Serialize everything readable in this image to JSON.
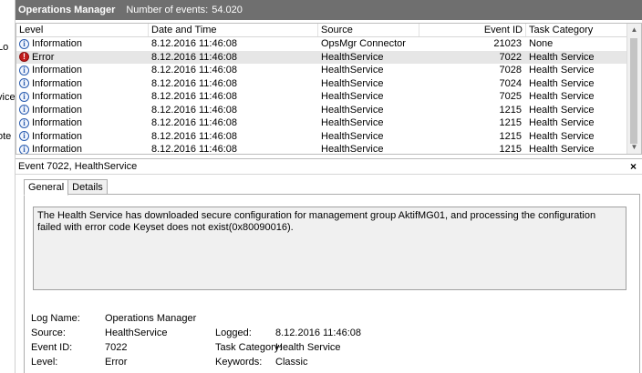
{
  "left_nav": {
    "fragments": [
      "Lo",
      "vice",
      "ote"
    ]
  },
  "header": {
    "title": "Operations Manager",
    "count_label": "Number of events:",
    "count_value": "54.020"
  },
  "columns": {
    "level": "Level",
    "date": "Date and Time",
    "source": "Source",
    "event_id": "Event ID",
    "task": "Task Category"
  },
  "events": [
    {
      "level": "Information",
      "icon": "info-icon",
      "date": "8.12.2016 11:46:08",
      "source": "OpsMgr Connector",
      "event_id": "21023",
      "task": "None"
    },
    {
      "level": "Error",
      "icon": "error-icon",
      "date": "8.12.2016 11:46:08",
      "source": "HealthService",
      "event_id": "7022",
      "task": "Health Service"
    },
    {
      "level": "Information",
      "icon": "info-icon",
      "date": "8.12.2016 11:46:08",
      "source": "HealthService",
      "event_id": "7028",
      "task": "Health Service"
    },
    {
      "level": "Information",
      "icon": "info-icon",
      "date": "8.12.2016 11:46:08",
      "source": "HealthService",
      "event_id": "7024",
      "task": "Health Service"
    },
    {
      "level": "Information",
      "icon": "info-icon",
      "date": "8.12.2016 11:46:08",
      "source": "HealthService",
      "event_id": "7025",
      "task": "Health Service"
    },
    {
      "level": "Information",
      "icon": "info-icon",
      "date": "8.12.2016 11:46:08",
      "source": "HealthService",
      "event_id": "1215",
      "task": "Health Service"
    },
    {
      "level": "Information",
      "icon": "info-icon",
      "date": "8.12.2016 11:46:08",
      "source": "HealthService",
      "event_id": "1215",
      "task": "Health Service"
    },
    {
      "level": "Information",
      "icon": "info-icon",
      "date": "8.12.2016 11:46:08",
      "source": "HealthService",
      "event_id": "1215",
      "task": "Health Service"
    },
    {
      "level": "Information",
      "icon": "info-icon",
      "date": "8.12.2016 11:46:08",
      "source": "HealthService",
      "event_id": "1215",
      "task": "Health Service"
    }
  ],
  "detail": {
    "title": "Event 7022, HealthService",
    "close_glyph": "×",
    "tabs": [
      "General",
      "Details"
    ],
    "message": "The Health Service has downloaded secure configuration for management group AktifMG01, and processing the configuration failed with error code Keyset does not exist(0x80090016).",
    "labels": {
      "log_name": "Log Name:",
      "source": "Source:",
      "event_id": "Event ID:",
      "level": "Level:",
      "logged": "Logged:",
      "task_category": "Task Category:",
      "keywords": "Keywords:"
    },
    "values": {
      "log_name": "Operations Manager",
      "source": "HealthService",
      "event_id": "7022",
      "level": "Error",
      "logged": "8.12.2016 11:46:08",
      "task_category": "Health Service",
      "keywords": "Classic"
    }
  },
  "colors": {
    "header_bg": "#6f6f6f",
    "selected_row": "#e6e6e6",
    "message_bg": "#f0f0f0",
    "error_red": "#c21c1c",
    "info_blue": "#2a5db0"
  }
}
